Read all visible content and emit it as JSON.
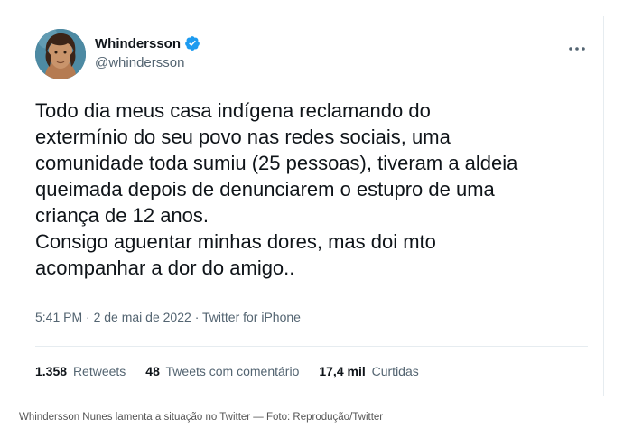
{
  "tweet": {
    "display_name": "Whindersson",
    "handle": "@whindersson",
    "text": "Todo dia meus casa indígena reclamando do\nextermínio do seu povo nas redes sociais, uma\ncomunidade toda sumiu (25 pessoas), tiveram a aldeia\nqueimada depois de denunciarem o estupro de uma\ncriança de 12 anos.\nConsigo aguentar minhas dores, mas doi mto\nacompanhar a dor do amigo..",
    "time": "5:41 PM",
    "date": "2 de mai de 2022",
    "source": "Twitter for iPhone",
    "separator": "·",
    "stats": {
      "retweets_count": "1.358",
      "retweets_label": "Retweets",
      "quotes_count": "48",
      "quotes_label": "Tweets com comentário",
      "likes_count": "17,4 mil",
      "likes_label": "Curtidas"
    }
  },
  "caption": "Whindersson Nunes lamenta a situação no Twitter — Foto: Reprodução/Twitter",
  "colors": {
    "text_primary": "#0f1419",
    "text_secondary": "#536471",
    "verified_blue": "#1d9bf0",
    "divider": "#e6ecf0"
  },
  "icons": [
    "verified-badge-icon",
    "more-options-icon"
  ]
}
